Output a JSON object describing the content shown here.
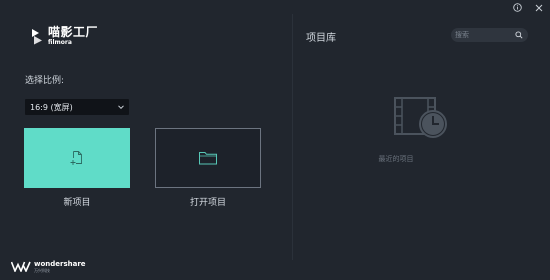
{
  "app": {
    "logo_cn": "喵影工厂",
    "logo_en": "filmora"
  },
  "titlebar": {
    "info_icon": "info-icon",
    "close_icon": "close-icon"
  },
  "left": {
    "ratio_label": "选择比例:",
    "ratio_selected": "16:9 (宽屏)",
    "new_project_label": "新项目",
    "open_project_label": "打开项目",
    "new_project_icon": "new-file-icon",
    "open_project_icon": "folder-icon"
  },
  "right": {
    "title": "项目库",
    "search_placeholder": "搜索",
    "empty_text": "最近的项目"
  },
  "footer": {
    "brand_en": "wondershare",
    "brand_cn": "万兴科技"
  },
  "colors": {
    "background": "#21262e",
    "accent": "#60dcc8",
    "card_border": "#6c7480"
  }
}
